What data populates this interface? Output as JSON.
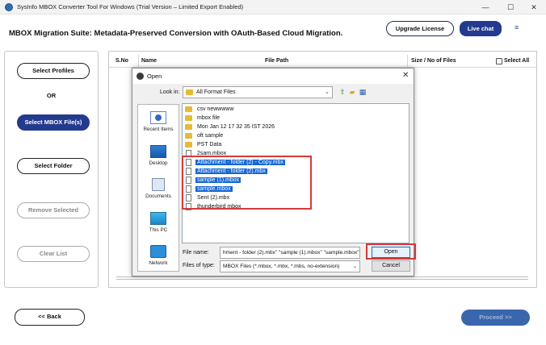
{
  "window": {
    "title": "SysInfo MBOX Converter Tool For Windows (Trial Version – Limited Export Enabled)",
    "minimize": "—",
    "maximize": "☐",
    "close": "✕"
  },
  "header": {
    "title": "MBOX Migration Suite: Metadata-Preserved Conversion with OAuth-Based Cloud Migration.",
    "upgrade_label": "Upgrade License",
    "live_chat_label": "Live chat",
    "menu_icon": "≡"
  },
  "sidebar": {
    "select_profiles": "Select Profiles",
    "or": "OR",
    "select_mbox": "Select MBOX File(s)",
    "select_folder": "Select Folder",
    "remove_selected": "Remove Selected",
    "clear_list": "Clear List"
  },
  "table": {
    "columns": [
      "S.No",
      "Name",
      "File Path",
      "Size / No of Files"
    ],
    "select_all": "Select All"
  },
  "footer": {
    "back_label": "<< Back",
    "proceed_label": "Proceed >>"
  },
  "dialog": {
    "title": "Open",
    "look_in_label": "Look in:",
    "look_in_value": "All Format Files",
    "places": [
      "Recent Items",
      "Desktop",
      "Documents",
      "This PC",
      "Network"
    ],
    "files": [
      {
        "name": "csv newwwww",
        "type": "folder",
        "selected": false
      },
      {
        "name": "mbox file",
        "type": "folder",
        "selected": false
      },
      {
        "name": "Mon Jan 12 17 32 35 IST 2026",
        "type": "folder",
        "selected": false
      },
      {
        "name": "oft sample",
        "type": "folder",
        "selected": false
      },
      {
        "name": "PST Data",
        "type": "folder",
        "selected": false
      },
      {
        "name": "2sam.mbox",
        "type": "file",
        "selected": false
      },
      {
        "name": "Attachment - folder (2) - Copy.mbx",
        "type": "file",
        "selected": true
      },
      {
        "name": "Attachment - folder (2).mbx",
        "type": "file",
        "selected": true
      },
      {
        "name": "sample (1).mbox",
        "type": "file",
        "selected": true
      },
      {
        "name": "sample.mbox",
        "type": "file",
        "selected": true
      },
      {
        "name": "Sent (2).mbx",
        "type": "file",
        "selected": false
      },
      {
        "name": "thunderbird mbox",
        "type": "file",
        "selected": false
      }
    ],
    "file_name_label": "File name:",
    "file_name_value": "hment - folder (2).mbx\" \"sample (1).mbox\" \"sample.mbox\"",
    "file_type_label": "Files of type:",
    "file_type_value": "MBOX Files (*.mbox, *.mbx, *.mbs, no-extension)",
    "open_label": "Open",
    "cancel_label": "Cancel",
    "close": "✕"
  },
  "colors": {
    "accent": "#243a8f",
    "selection": "#1567d3",
    "highlight_box": "#d33a3a"
  }
}
